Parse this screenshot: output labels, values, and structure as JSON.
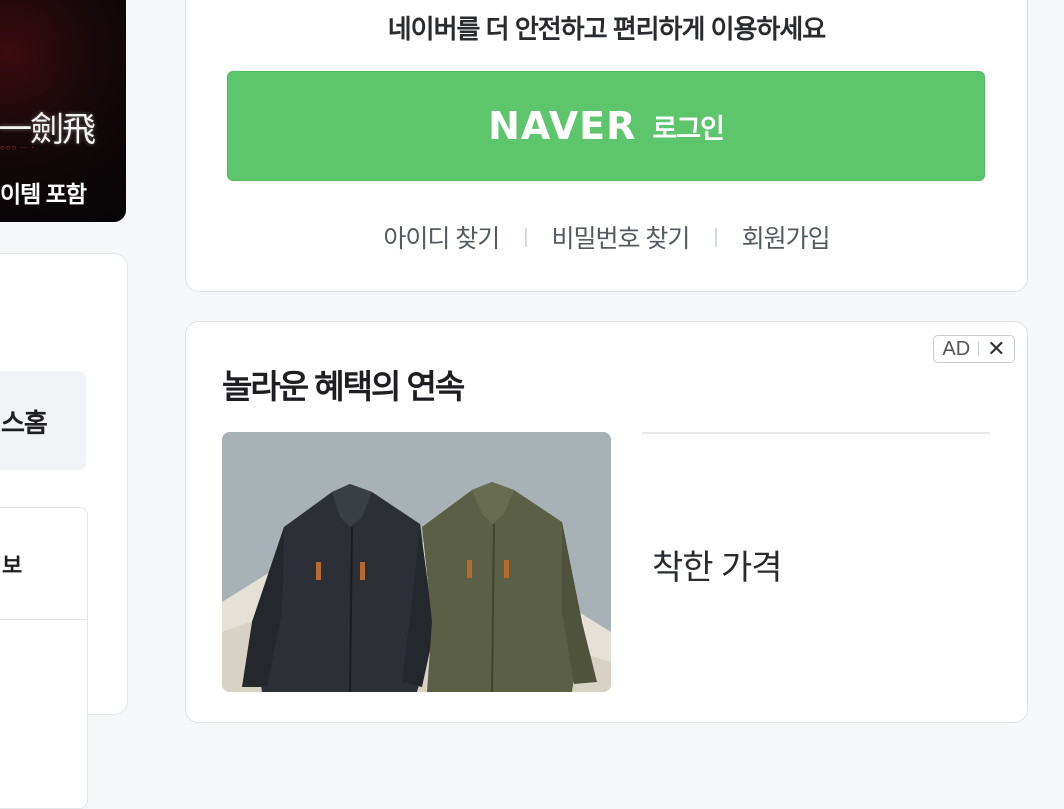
{
  "left_banner": {
    "logo_text": "一劍飛",
    "caption": "이템 포함"
  },
  "left_panel": {
    "shop_home": "스홈",
    "info": "보"
  },
  "login": {
    "message": "네이버를 더 안전하고 편리하게 이용하세요",
    "brand": "NAVER",
    "button_label": "로그인",
    "button_color": "#5dc56b",
    "links": [
      "아이디 찾기",
      "비밀번호 찾기",
      "회원가입"
    ]
  },
  "ad": {
    "title": "놀라운 혜택의 연속",
    "badge": "AD",
    "close_symbol": "✕",
    "tagline": "착한 가격",
    "image_subject": "two-jackets"
  }
}
